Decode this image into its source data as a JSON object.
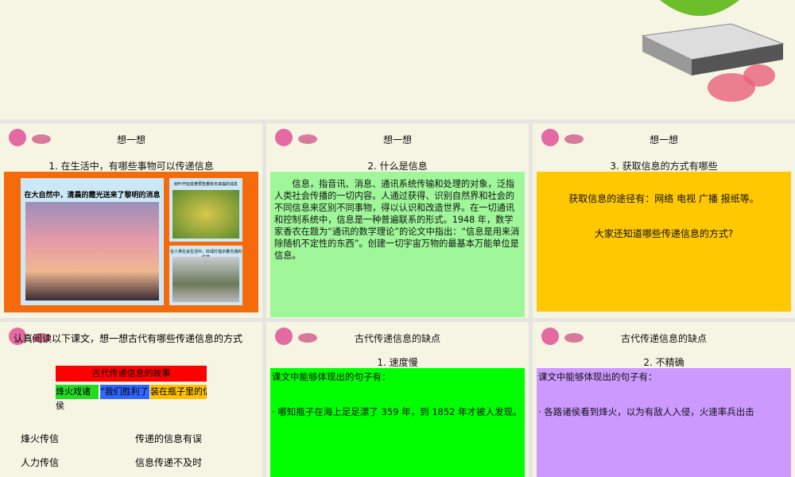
{
  "slides": [
    {
      "heading": "想一想",
      "subtitle": "1. 在生活中，有哪些事物可以传递信息",
      "captions": [
        "在大自然中，清晨的霞光送来了黎明的消息",
        "树叶开始变黄预告着秋天来临的消息",
        "在人类社会生活中，红绿灯指示着交通的信息"
      ]
    },
    {
      "heading": "想一想",
      "subtitle": "2. 什么是信息",
      "body": "信息，指音讯、消息、通讯系统传输和处理的对象，泛指人类社会传播的一切内容。人通过获得、识别自然界和社会的不同信息来区别不同事物，得以认识和改造世界。在一切通讯和控制系统中，信息是一种普遍联系的形式。1948 年，数学家香农在题为“通讯的数学理论”的论文中指出：“信息是用来消除随机不定性的东西”。创建一切宇宙万物的最基本万能单位是信息。"
    },
    {
      "heading": "想一想",
      "subtitle": "3. 获取信息的方式有哪些",
      "line1": "获取信息的途径有：网络 电视 广播 报纸等。",
      "line2": "大家还知道哪些传递信息的方式?"
    },
    {
      "heading": "认真阅读以下课文，想一想古代有哪些传递信息的方式",
      "story_title": "古代传递信息的故事",
      "stories": [
        "烽火戏诸侯",
        "“我们胜利了”",
        "装在瓶子里的信"
      ],
      "rows": [
        [
          "烽火传信",
          "传递的信息有误"
        ],
        [
          "人力传信",
          "信息传递不及时"
        ]
      ]
    },
    {
      "heading": "古代传递信息的缺点",
      "subtitle": "1. 速度慢",
      "label": "课文中能够体现出的句子有：",
      "sentence": "· 哪知瓶子在海上足足漂了 359 年，到 1852 年才被人发现。"
    },
    {
      "heading": "古代传递信息的缺点",
      "subtitle": "2. 不精确",
      "label": "课文中能够体现出的句子有：",
      "sentence": "· 各路诸侯看到烽火，以为有敌人入侵，火速率兵出击"
    }
  ]
}
